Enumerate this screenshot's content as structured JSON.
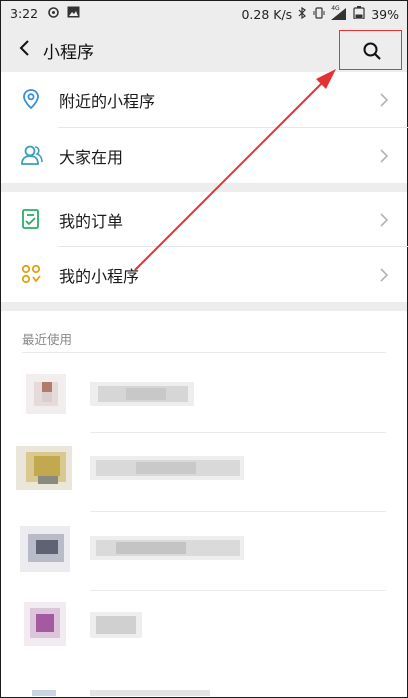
{
  "status": {
    "time": "3:22",
    "speed": "0.28 K/s",
    "network": "4G",
    "battery": "39%"
  },
  "header": {
    "title": "小程序",
    "back_icon": "back-chevron-icon",
    "search_icon": "search-icon"
  },
  "menu": {
    "items": [
      {
        "label": "附近的小程序",
        "icon": "location-pin-icon",
        "color": "#3a8fd8"
      },
      {
        "label": "大家在用",
        "icon": "people-icon",
        "color": "#3aa0b8"
      },
      {
        "label": "我的订单",
        "icon": "order-list-icon",
        "color": "#2aae67"
      },
      {
        "label": "我的小程序",
        "icon": "mini-program-icon",
        "color": "#e0a412"
      }
    ]
  },
  "recent": {
    "section_label": "最近使用"
  },
  "colors": {
    "background": "#ededed",
    "highlight": "#e33333"
  }
}
